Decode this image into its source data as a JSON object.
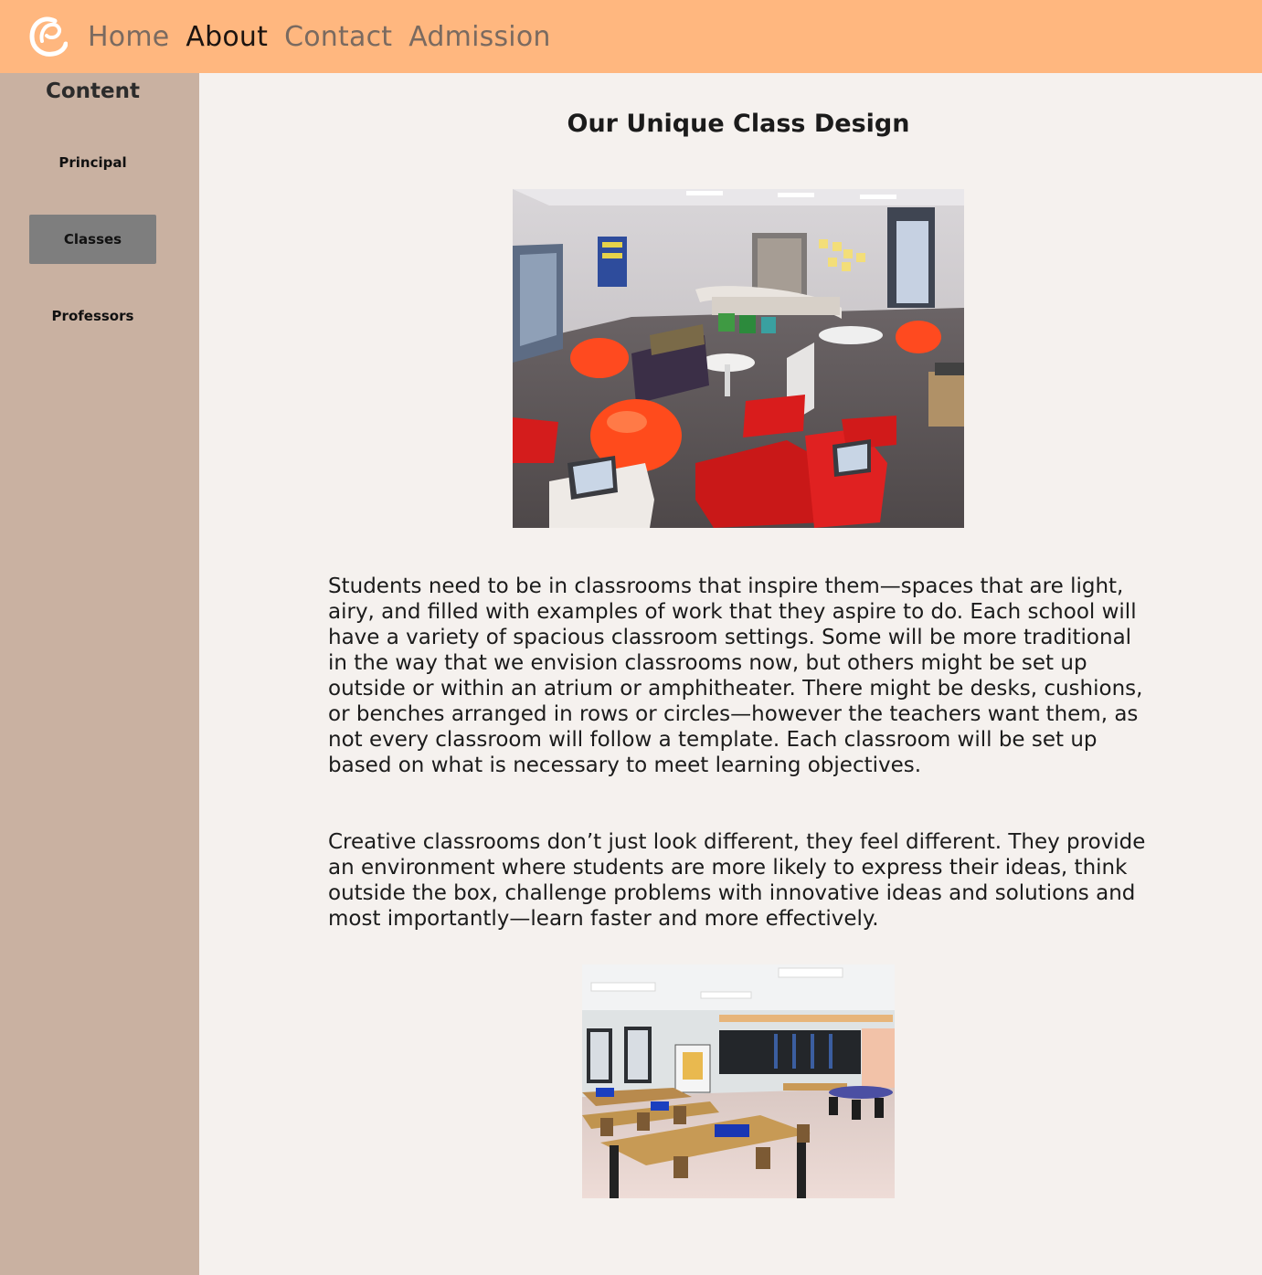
{
  "nav": {
    "items": [
      {
        "label": "Home",
        "active": false
      },
      {
        "label": "About",
        "active": true
      },
      {
        "label": "Contact",
        "active": false
      },
      {
        "label": "Admission",
        "active": false
      }
    ],
    "colors": {
      "bar": "#ffb77f",
      "inactive": "#7a6a60",
      "active": "#1c1410"
    }
  },
  "sidebar": {
    "title": "Content",
    "items": [
      {
        "label": "Principal",
        "active": false
      },
      {
        "label": "Classes",
        "active": true
      },
      {
        "label": "Professors",
        "active": false
      }
    ],
    "colors": {
      "background": "#c9b1a1",
      "active": "#7e7e7e"
    }
  },
  "main": {
    "title": "Our Unique Class Design",
    "paragraphs": [
      "Students need to be in classrooms that inspire them—spaces that are light, airy, and filled with examples of work that they aspire to do. Each school will have a variety of spacious classroom settings. Some will be more traditional in the way that we envision classrooms now, but others might be set up outside or within an atrium or amphitheater. There might be desks, cushions, or benches arranged in rows or circles—however the teachers want them, as not every classroom will follow a template. Each classroom will be set up based on what is necessary to meet learning objectives.",
      "Creative classrooms don’t just look different, they feel different. They provide an environment where students are more likely to express their ideas, think outside the box, challenge problems with innovative ideas and solutions and most importantly—learn faster and more effectively."
    ],
    "images": [
      {
        "name": "classroom-photo-flexible-seating"
      },
      {
        "name": "classroom-photo-traditional-desks"
      }
    ]
  }
}
